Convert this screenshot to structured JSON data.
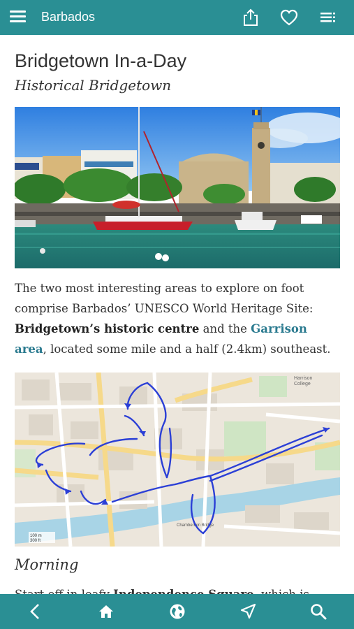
{
  "topbar": {
    "title": "Barbados",
    "menu_icon": "hamburger-menu-icon",
    "share_icon": "share-icon",
    "favorite_icon": "heart-icon",
    "toc_icon": "list-icon",
    "color": "#2a8f94"
  },
  "page": {
    "title": "Bridgetown In-a-Day",
    "subtitle": "Historical Bridgetown"
  },
  "intro": {
    "part1": "The two most interesting areas to explore on foot comprise Barbados’ UNESCO World Heritage Site: ",
    "bold": "Bridgetown’s historic centre",
    "part2": " and the ",
    "link": "Garrison area",
    "part3": ", located some mile and a half (2.4km) southeast."
  },
  "map": {
    "labels": {
      "college": "Harrison\nCollege",
      "chamberlain": "Chamberlain Bridge",
      "scale_m": "100 m",
      "scale_ft": "300 ft"
    }
  },
  "section": {
    "heading": "Morning",
    "text_part1": "Start off in leafy ",
    "text_bold": "Independence Square",
    "text_part2": ", which is"
  },
  "bottombar": {
    "back_icon": "chevron-left-icon",
    "home_icon": "home-icon",
    "globe_icon": "globe-icon",
    "navigate_icon": "navigation-arrow-icon",
    "search_icon": "search-icon"
  }
}
